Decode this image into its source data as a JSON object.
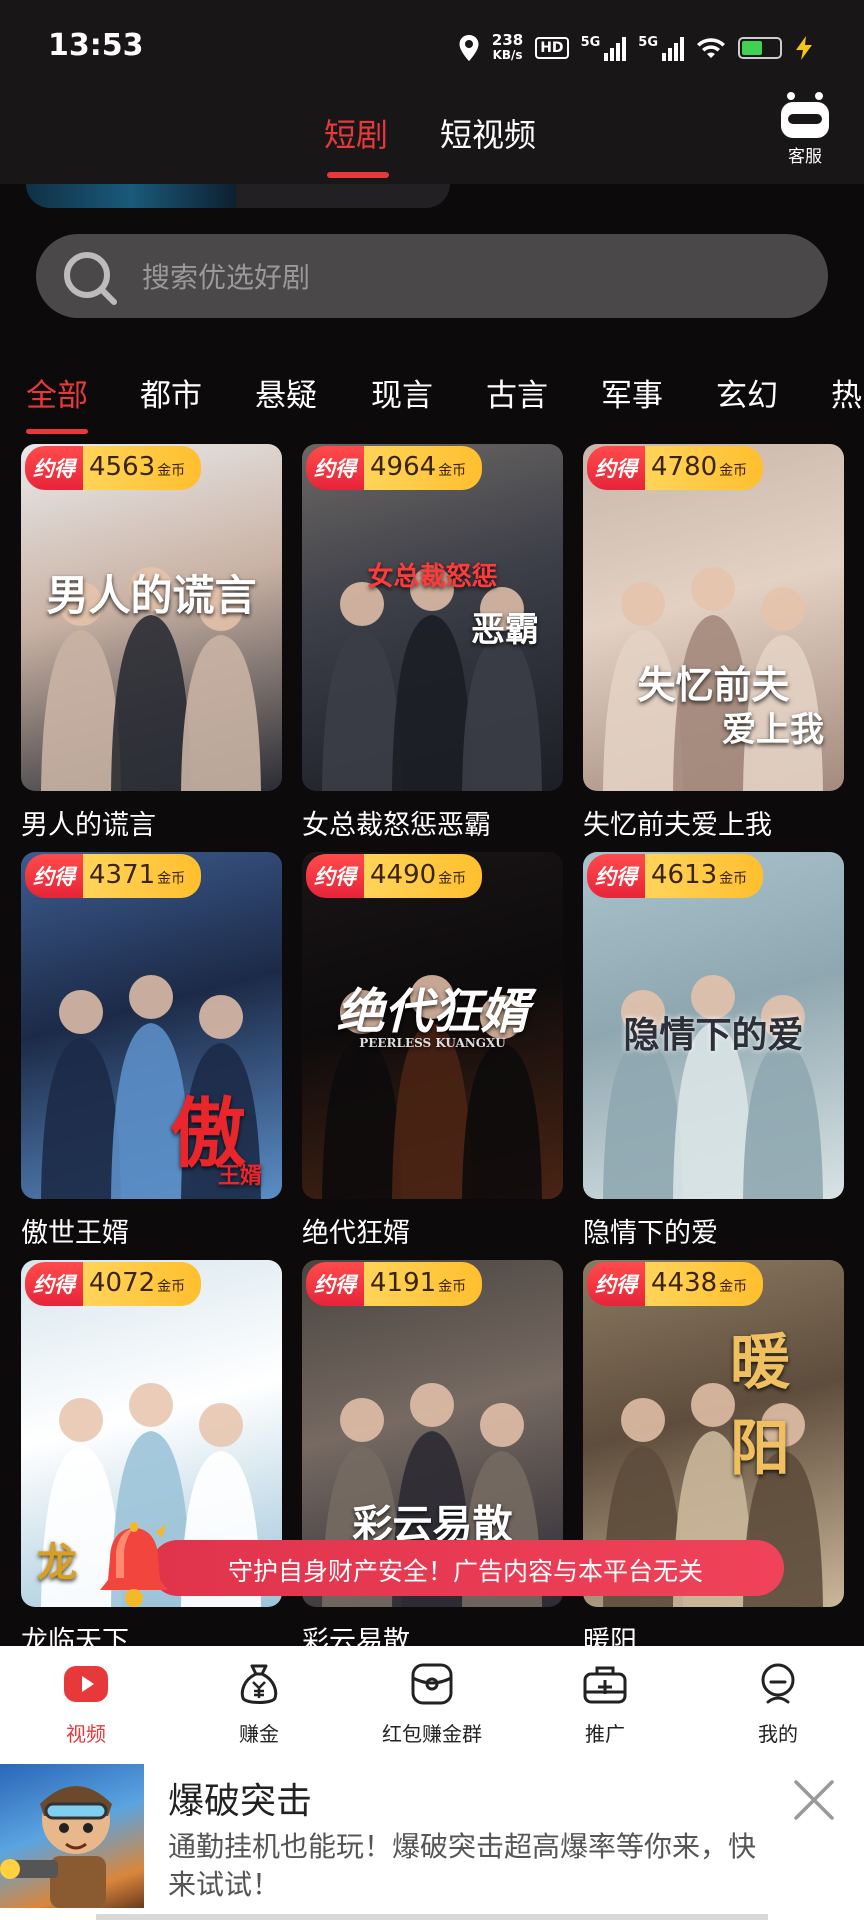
{
  "status_bar": {
    "time": "13:53",
    "net_speed_value": "238",
    "net_speed_unit": "KB/s",
    "hd_label": "HD",
    "signal_label_1": "5G",
    "signal_label_2": "5G",
    "battery_level": 0.55
  },
  "header": {
    "tabs": [
      {
        "label": "短剧",
        "active": true
      },
      {
        "label": "短视频",
        "active": false
      }
    ],
    "service_label": "客服"
  },
  "search": {
    "placeholder": "搜索优选好剧"
  },
  "categories": [
    {
      "label": "全部",
      "active": true
    },
    {
      "label": "都市"
    },
    {
      "label": "悬疑"
    },
    {
      "label": "现言"
    },
    {
      "label": "古言"
    },
    {
      "label": "军事"
    },
    {
      "label": "玄幻"
    },
    {
      "label": "热"
    }
  ],
  "badge": {
    "tag": "约得",
    "unit": "金币"
  },
  "dramas": [
    {
      "title": "男人的谎言",
      "coins": "4563",
      "poster_text": "男人的谎言",
      "colors": [
        "#e9e9ea",
        "#2a2c34",
        "#c9b2a4"
      ]
    },
    {
      "title": "女总裁怒惩恶霸",
      "coins": "4964",
      "poster_text": "女总裁怒惩",
      "poster_sub": "恶霸",
      "colors": [
        "#6b6763",
        "#1c1e26",
        "#3b3d47"
      ]
    },
    {
      "title": "失忆前夫爱上我",
      "coins": "4780",
      "poster_text": "失忆前夫",
      "poster_sub": "爱上我",
      "colors": [
        "#c8b6aa",
        "#a38a7c",
        "#e3d1c4"
      ]
    },
    {
      "title": "傲世王婿",
      "coins": "4371",
      "poster_text": "傲",
      "poster_sub": "王婿",
      "colors": [
        "#3d5c8f",
        "#5b8ec7",
        "#1c2a47"
      ]
    },
    {
      "title": "绝代狂婿",
      "coins": "4490",
      "poster_text": "绝代狂婿",
      "poster_sub": "PEERLESS KUANGXU",
      "colors": [
        "#1a1516",
        "#4a2414",
        "#0d0b0c"
      ]
    },
    {
      "title": "隐情下的爱",
      "coins": "4613",
      "poster_text": "隐情下的爱",
      "colors": [
        "#a9c3cc",
        "#d8e3e4",
        "#8fa7b0"
      ]
    },
    {
      "title": "龙临天下",
      "coins": "4072",
      "poster_text": "龙",
      "colors": [
        "#d7e6ee",
        "#9cc3d8",
        "#ffffff"
      ]
    },
    {
      "title": "彩云易散",
      "coins": "4191",
      "poster_text": "彩云易散",
      "colors": [
        "#4a4440",
        "#2c2a33",
        "#766a62"
      ]
    },
    {
      "title": "暖阳",
      "coins": "4438",
      "poster_text": "暖阳",
      "colors": [
        "#8b7a62",
        "#cbb79a",
        "#5e4d3c"
      ]
    }
  ],
  "notice": {
    "text": "守护自身财产安全！广告内容与本平台无关"
  },
  "bottom_nav": [
    {
      "label": "视频",
      "active": true,
      "icon": "play-icon"
    },
    {
      "label": "赚金",
      "active": false,
      "icon": "money-bag-icon"
    },
    {
      "label": "红包赚金群",
      "active": false,
      "icon": "red-packet-icon"
    },
    {
      "label": "推广",
      "active": false,
      "icon": "promote-icon"
    },
    {
      "label": "我的",
      "active": false,
      "icon": "profile-icon"
    }
  ],
  "ad": {
    "title": "爆破突击",
    "description": "通勤挂机也能玩！爆破突击超高爆率等你来，快来试试！"
  }
}
